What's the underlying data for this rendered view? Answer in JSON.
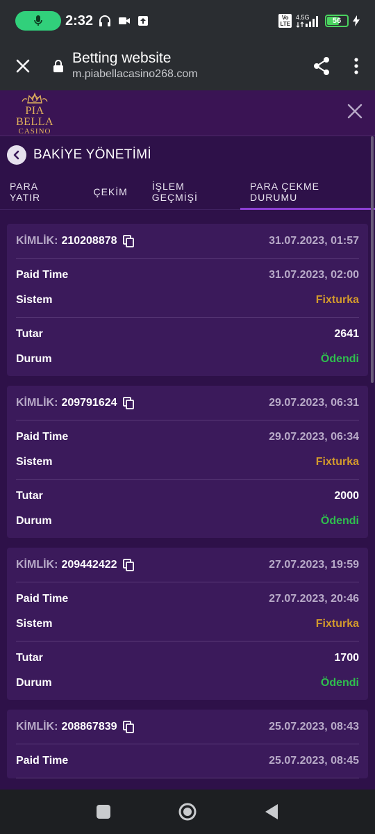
{
  "status_bar": {
    "time": "2:32",
    "volte_label": "Vo\nLTE",
    "network_label": "4.5G",
    "battery_level": "56",
    "battery_percent": 56
  },
  "browser": {
    "title": "Betting website",
    "url": "m.piabellacasino268.com"
  },
  "site": {
    "logo_title": "PIA BELLA",
    "logo_sub": "CASINO"
  },
  "page": {
    "title": "BAKİYE YÖNETİMİ",
    "tabs": [
      {
        "label": "PARA YATIR"
      },
      {
        "label": "ÇEKİM"
      },
      {
        "label": "İŞLEM GEÇMİŞİ"
      },
      {
        "label": "PARA ÇEKME DURUMU"
      }
    ]
  },
  "labels": {
    "id": "KİMLİK:",
    "paid_time": "Paid Time",
    "system": "Sistem",
    "amount": "Tutar",
    "status": "Durum"
  },
  "records": [
    {
      "id": "210208878",
      "date": "31.07.2023, 01:57",
      "paid_time": "31.07.2023, 02:00",
      "system": "Fixturka",
      "amount": "2641",
      "status": "Ödendi"
    },
    {
      "id": "209791624",
      "date": "29.07.2023, 06:31",
      "paid_time": "29.07.2023, 06:34",
      "system": "Fixturka",
      "amount": "2000",
      "status": "Ödendi"
    },
    {
      "id": "209442422",
      "date": "27.07.2023, 19:59",
      "paid_time": "27.07.2023, 20:46",
      "system": "Fixturka",
      "amount": "1700",
      "status": "Ödendi"
    },
    {
      "id": "208867839",
      "date": "25.07.2023, 08:43",
      "paid_time": "25.07.2023, 08:45",
      "system": "",
      "amount": "",
      "status": ""
    }
  ],
  "colors": {
    "brand_purple": "#2e1149",
    "card": "#3b1a5b",
    "accent": "#8d3fd4",
    "gold": "#d39a2c",
    "success": "#2fbf4e"
  }
}
